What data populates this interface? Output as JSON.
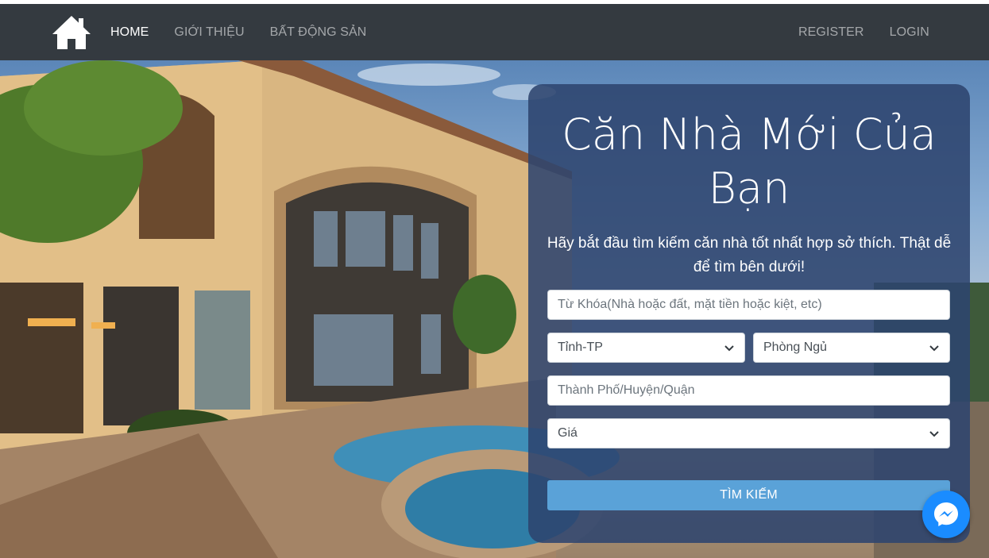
{
  "nav": {
    "brand_icon": "home-icon",
    "links": [
      {
        "label": "HOME",
        "active": true
      },
      {
        "label": "GIỚI THIỆU",
        "active": false
      },
      {
        "label": "BẤT ĐỘNG SẢN",
        "active": false
      }
    ],
    "right_links": [
      {
        "label": "REGISTER"
      },
      {
        "label": "LOGIN"
      }
    ]
  },
  "search_panel": {
    "title": "Căn Nhà Mới Của Bạn",
    "subtitle": "Hãy bắt đầu tìm kiếm căn nhà tốt nhất hợp sở thích. Thật dễ để tìm bên dưới!",
    "keyword_placeholder": "Từ Khóa(Nhà hoặc đất, mặt tiền hoặc kiệt, etc)",
    "province_select": "Tỉnh-TP",
    "bedroom_select": "Phòng Ngủ",
    "district_placeholder": "Thành Phố/Huyện/Quận",
    "price_select": "Giá",
    "search_button": "TÌM KIẾM"
  },
  "colors": {
    "navbar": "#343a40",
    "panel": "#2d446e",
    "button": "#5aa2d8",
    "messenger": "#1a8cff"
  },
  "floating": {
    "messenger_icon": "messenger-icon"
  }
}
